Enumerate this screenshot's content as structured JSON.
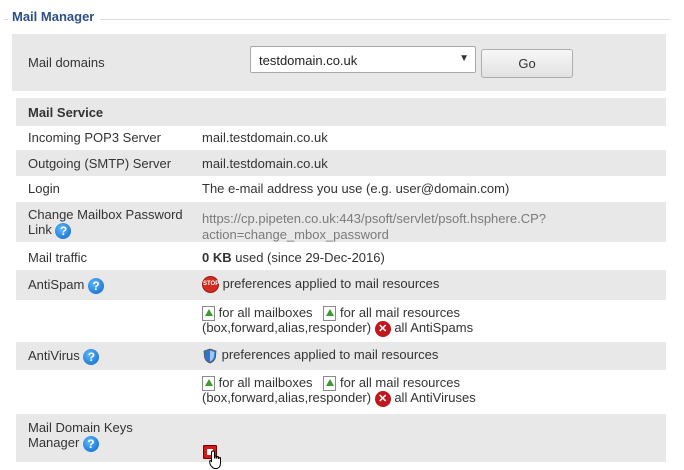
{
  "section": {
    "title": "Mail Manager"
  },
  "domain_select": {
    "label": "Mail domains",
    "selected": "testdomain.co.uk",
    "go_label": "Go"
  },
  "mail_service": {
    "heading": "Mail Service",
    "incoming": {
      "label": "Incoming POP3 Server",
      "value": "mail.testdomain.co.uk"
    },
    "outgoing": {
      "label": "Outgoing (SMTP) Server",
      "value": "mail.testdomain.co.uk"
    },
    "login": {
      "label": "Login",
      "value": "The e-mail address you use (e.g. user@domain.com)"
    },
    "change_password": {
      "label_line1": "Change Mailbox Password",
      "label_line2": "Link",
      "url_line1": "https://cp.pipeten.co.uk:443/psoft/servlet/psoft.hsphere.CP?",
      "url_line2": "action=change_mbox_password"
    },
    "traffic": {
      "label": "Mail traffic",
      "amount": "0 KB",
      "suffix": " used (since 29-Dec-2016)"
    },
    "antispam": {
      "label": "AntiSpam",
      "preferences": "preferences applied to mail resources",
      "stop_icon_text": "STOP",
      "for_mailboxes": "for all mailboxes",
      "for_resources": "for all mail resources",
      "resource_types": "(box,forward,alias,responder)",
      "remove_all": "all AntiSpams"
    },
    "antivirus": {
      "label": "AntiVirus",
      "preferences": "preferences applied to mail resources",
      "for_mailboxes": "for all mailboxes",
      "for_resources": "for all mail resources",
      "resource_types": "(box,forward,alias,responder)",
      "remove_all": "all AntiViruses"
    },
    "dkim": {
      "label_line1": "Mail Domain Keys",
      "label_line2": "Manager"
    }
  },
  "icons": {
    "help": "help-icon",
    "stop": "stop-icon",
    "shield": "shield-icon",
    "enable": "green-up-arrow-icon",
    "remove": "red-x-icon",
    "dkim_toggle": "red-square-icon",
    "cursor": "hand-cursor-icon"
  },
  "colors": {
    "title": "#2c4f87",
    "row_alt": "#e8e8e8",
    "link": "#7a7a7a",
    "help_blue": "#0b63c7",
    "stop_red": "#d42b1e",
    "enable_green": "#3a9d2b"
  }
}
